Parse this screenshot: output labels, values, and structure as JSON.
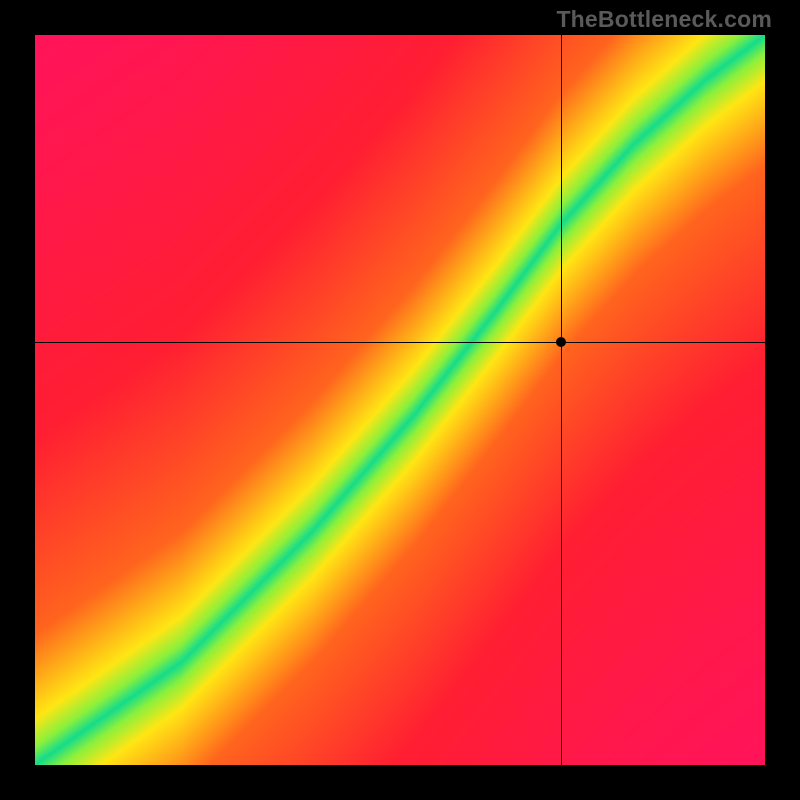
{
  "attribution": "TheBottleneck.com",
  "chart_data": {
    "type": "heatmap",
    "title": "",
    "xlabel": "",
    "ylabel": "",
    "xlim": [
      0,
      100
    ],
    "ylim": [
      0,
      100
    ],
    "crosshair": {
      "x": 72,
      "y": 58
    },
    "marker": {
      "x": 72,
      "y": 58
    },
    "ideal_curve_control_points": [
      {
        "x": 0,
        "y": 0
      },
      {
        "x": 20,
        "y": 14
      },
      {
        "x": 38,
        "y": 32
      },
      {
        "x": 52,
        "y": 48
      },
      {
        "x": 63,
        "y": 62
      },
      {
        "x": 72,
        "y": 74
      },
      {
        "x": 82,
        "y": 85
      },
      {
        "x": 92,
        "y": 94
      },
      {
        "x": 100,
        "y": 100
      }
    ],
    "optimal_band_halfwidth": 4.5,
    "color_scale_note": "green = on optimal curve, yellow = near, red = far"
  }
}
